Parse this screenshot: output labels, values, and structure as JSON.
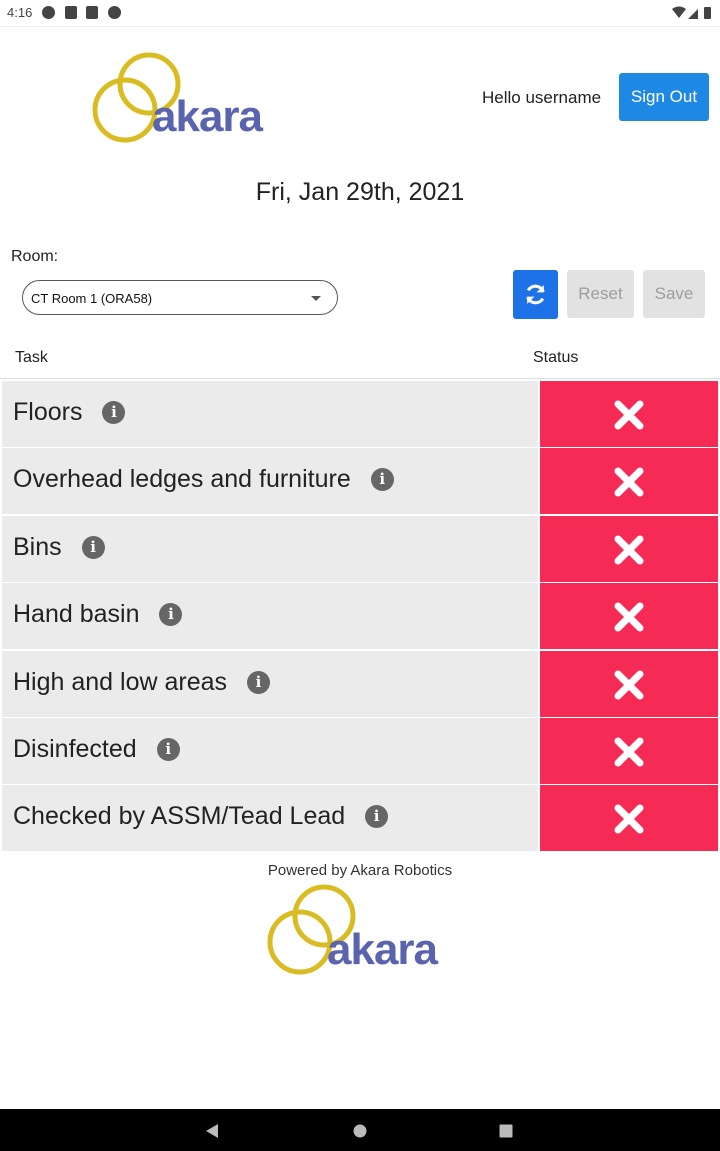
{
  "status_bar": {
    "time": "4:16"
  },
  "header": {
    "logo_text": "akara",
    "greeting": "Hello username",
    "sign_out_label": "Sign Out"
  },
  "date": "Fri, Jan 29th, 2021",
  "room": {
    "label": "Room:",
    "selected": "CT Room 1 (ORA58)"
  },
  "actions": {
    "refresh_icon": "refresh-icon",
    "reset_label": "Reset",
    "save_label": "Save"
  },
  "table": {
    "headers": {
      "task": "Task",
      "status": "Status"
    },
    "rows": [
      {
        "task": "Floors",
        "status": "incomplete"
      },
      {
        "task": "Overhead ledges and furniture",
        "status": "incomplete"
      },
      {
        "task": "Bins",
        "status": "incomplete"
      },
      {
        "task": "Hand basin",
        "status": "incomplete"
      },
      {
        "task": "High and low areas",
        "status": "incomplete"
      },
      {
        "task": "Disinfected",
        "status": "incomplete"
      },
      {
        "task": "Checked by ASSM/Tead Lead",
        "status": "incomplete"
      }
    ],
    "status_color": "#f52a55"
  },
  "footer": {
    "powered_by": "Powered by Akara Robotics",
    "logo_text": "akara"
  },
  "colors": {
    "primary": "#1e88e5",
    "brand_text": "#5a63ad",
    "brand_gold": "#d4b820"
  }
}
